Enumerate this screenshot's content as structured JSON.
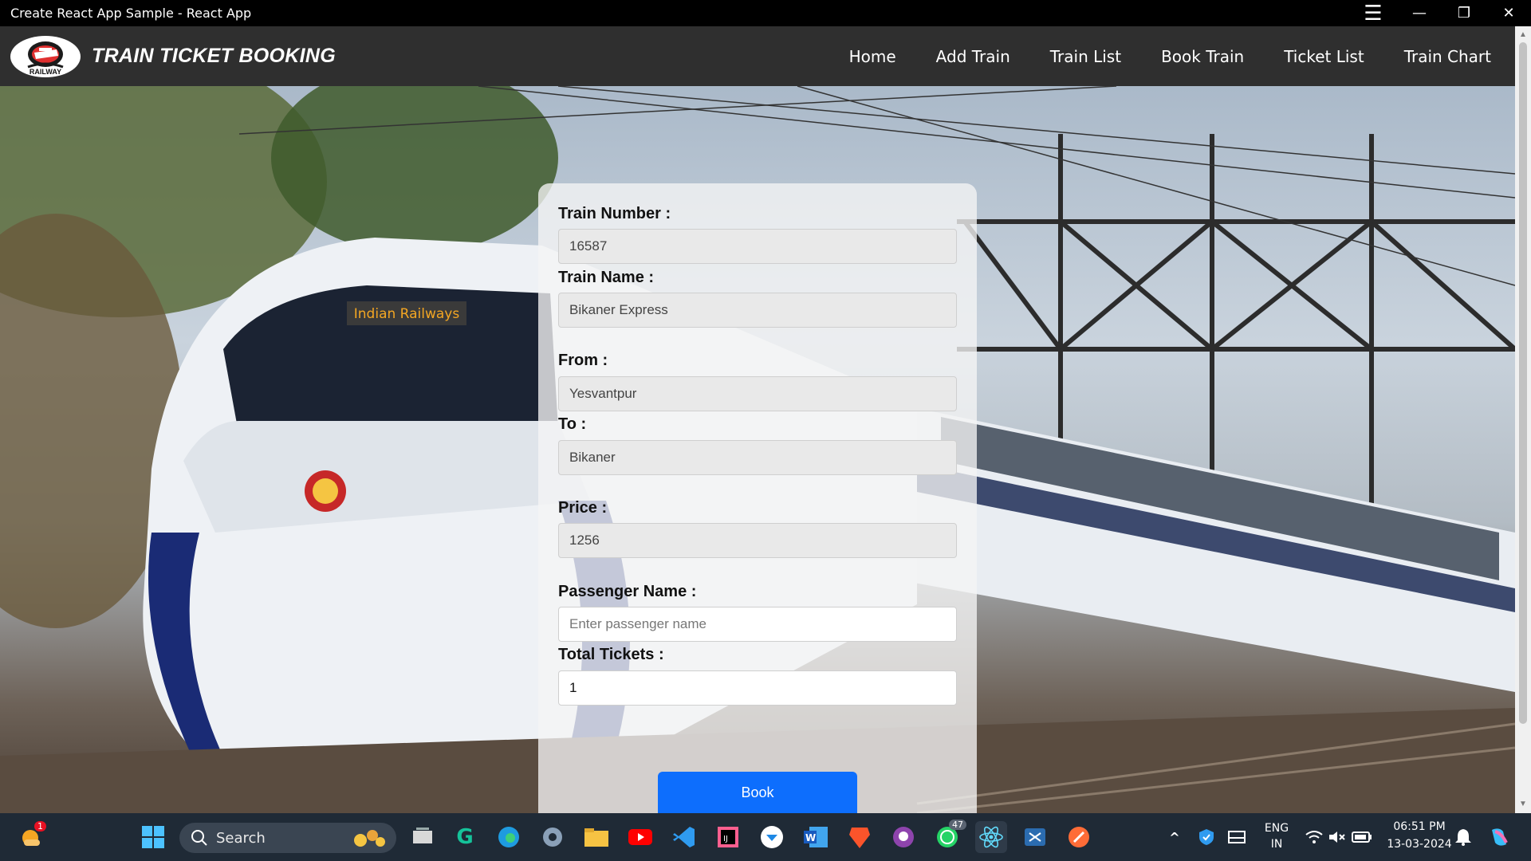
{
  "window": {
    "title": "Create React App Sample - React App"
  },
  "navbar": {
    "logo_text": "RAILWAY",
    "brand": "TRAIN TICKET BOOKING",
    "links": [
      "Home",
      "Add Train",
      "Train List",
      "Book Train",
      "Ticket List",
      "Train Chart"
    ]
  },
  "scene": {
    "train_sign": "Indian Railways"
  },
  "form": {
    "train_number_label": "Train Number :",
    "train_number_value": "16587",
    "train_name_label": "Train Name :",
    "train_name_value": "Bikaner Express",
    "from_label": "From :",
    "from_value": "Yesvantpur",
    "to_label": "To :",
    "to_value": "Bikaner",
    "price_label": "Price :",
    "price_value": "1256",
    "passenger_name_label": "Passenger Name :",
    "passenger_name_placeholder": "Enter passenger name",
    "passenger_name_value": "",
    "total_tickets_label": "Total Tickets :",
    "total_tickets_value": "1",
    "book_button": "Book"
  },
  "taskbar": {
    "search_label": "Search",
    "weather_badge": "1",
    "whatsapp_badge": "47",
    "language": "ENG",
    "region": "IN",
    "time": "06:51 PM",
    "date": "13-03-2024"
  },
  "colors": {
    "navbar": "#2f2f2f",
    "primary_button": "#0d6efd",
    "taskbar": "#1f2a36"
  }
}
